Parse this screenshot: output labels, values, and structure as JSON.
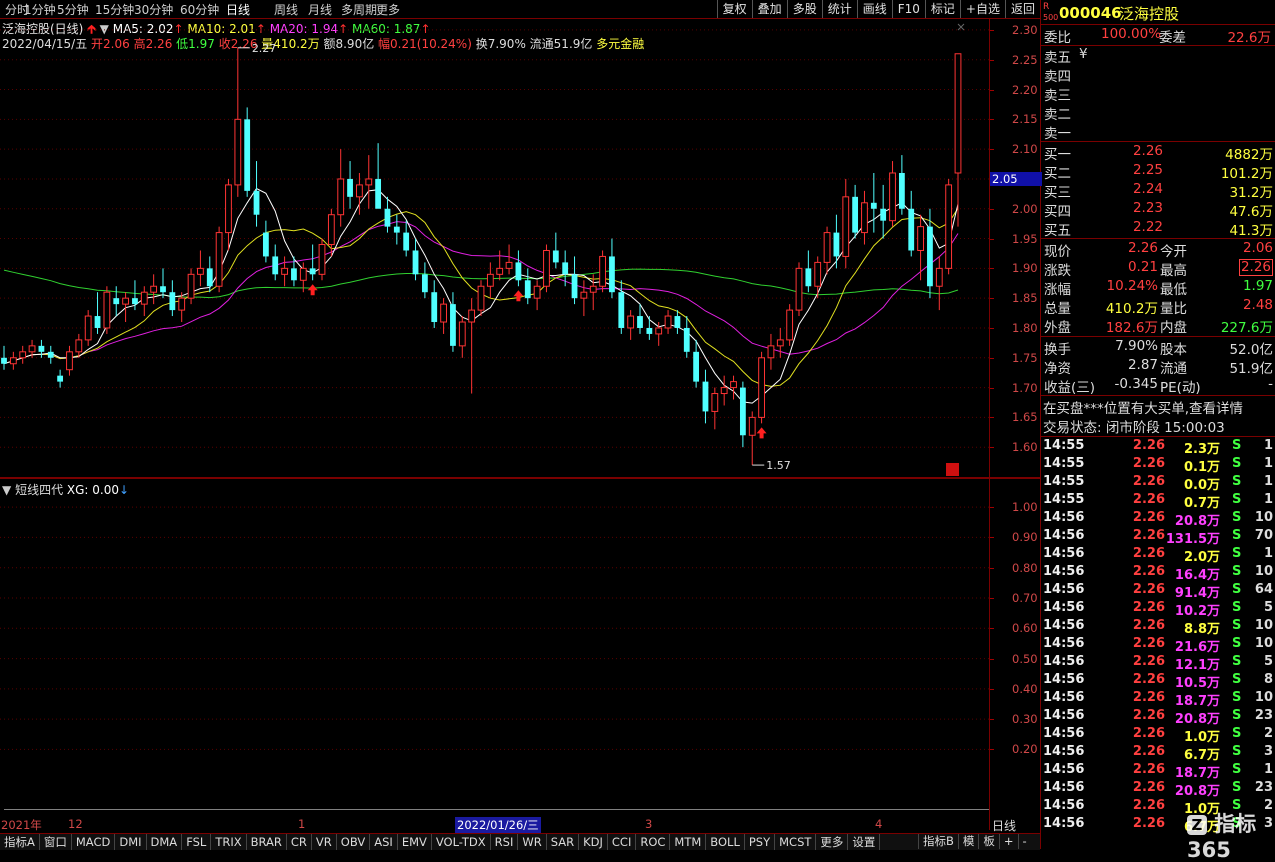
{
  "toolbar": {
    "timeframes": [
      "分时",
      "1分钟",
      "5分钟",
      "15分钟",
      "30分钟",
      "60分钟",
      "日线",
      "周线",
      "月线",
      "多周期",
      "更多"
    ],
    "active_timeframe": "日线",
    "buttons": [
      "复权",
      "叠加",
      "多股",
      "统计",
      "画线",
      "F10",
      "标记",
      "+自选",
      "返回"
    ]
  },
  "chart_header": {
    "name": "泛海控股(日线)",
    "ma5": "MA5: 2.02",
    "ma10": "MA10: 2.01",
    "ma20": "MA20: 1.94",
    "ma60": "MA60: 1.87"
  },
  "day_info": {
    "date": "2022/04/15/五",
    "open": "开2.06",
    "high": "高2.26",
    "low": "低1.97",
    "close": "收2.26",
    "volume": "量410.2万",
    "amount": "额8.90亿",
    "change": "幅0.21(10.24%)",
    "turnover": "换7.90%",
    "float": "流通51.9亿",
    "concept": "多元金融"
  },
  "indicator": {
    "name": "短线四代",
    "value": "XG: 0.00"
  },
  "bottom_tabs": [
    "指标A",
    "窗口",
    "MACD",
    "DMI",
    "DMA",
    "FSL",
    "TRIX",
    "BRAR",
    "CR",
    "VR",
    "OBV",
    "ASI",
    "EMV",
    "VOL-TDX",
    "RSI",
    "WR",
    "SAR",
    "KDJ",
    "CCI",
    "ROC",
    "MTM",
    "BOLL",
    "PSY",
    "MCST",
    "更多",
    "设置"
  ],
  "bottom_right": [
    "指标B",
    "模",
    "板",
    "+",
    "-"
  ],
  "axis_right_label": "日线",
  "date_labels": [
    {
      "text": "2021年",
      "highlight": false
    },
    {
      "text": "12",
      "highlight": false
    },
    {
      "text": "1",
      "highlight": false
    },
    {
      "text": "2022/01/26/三",
      "highlight": true
    },
    {
      "text": "3",
      "highlight": false
    },
    {
      "text": "4",
      "highlight": false
    }
  ],
  "chart_data": {
    "type": "candlestick",
    "price_ticks": [
      "2.30",
      "2.25",
      "2.20",
      "2.15",
      "2.10",
      "2.05",
      "2.00",
      "1.95",
      "1.90",
      "1.85",
      "1.80",
      "1.75",
      "1.70",
      "1.65",
      "1.60"
    ],
    "ylim": [
      1.55,
      2.32
    ],
    "current_price_tag": "2.05",
    "high_annotation": "2.27",
    "low_annotation": "1.57",
    "indicator_ticks": [
      "1.00",
      "0.90",
      "0.80",
      "0.70",
      "0.60",
      "0.50",
      "0.40",
      "0.30",
      "0.20"
    ],
    "indicator_ylim": [
      0,
      1.05
    ],
    "indicator_values": [
      0,
      0,
      0,
      0,
      0,
      0,
      0,
      0,
      0,
      0,
      0,
      0,
      0,
      0,
      0,
      0,
      0,
      0,
      0,
      0,
      0,
      0,
      0,
      0,
      0,
      0,
      0,
      0,
      0,
      0,
      0,
      0,
      0,
      0,
      0,
      0,
      0,
      0,
      0,
      0,
      0,
      0,
      0,
      0,
      0,
      0,
      0,
      0,
      0,
      0,
      0,
      0,
      0,
      0,
      0,
      0,
      0,
      0,
      0,
      0,
      0,
      0,
      0,
      0,
      0,
      0,
      0,
      0,
      0,
      0,
      0,
      0,
      0,
      0,
      0,
      0,
      0,
      0,
      0,
      0,
      0,
      0,
      0,
      0,
      0,
      0,
      0,
      0,
      0,
      0,
      0,
      0,
      0,
      0,
      0,
      0,
      0,
      0,
      0,
      0,
      0,
      0,
      0,
      0,
      0,
      0,
      0,
      0,
      0,
      0,
      0,
      0,
      0,
      0,
      0,
      1,
      0
    ],
    "candles": [
      [
        1.75,
        1.77,
        1.73,
        1.74
      ],
      [
        1.74,
        1.76,
        1.73,
        1.75
      ],
      [
        1.75,
        1.77,
        1.74,
        1.76
      ],
      [
        1.76,
        1.78,
        1.75,
        1.77
      ],
      [
        1.77,
        1.78,
        1.75,
        1.76
      ],
      [
        1.76,
        1.77,
        1.74,
        1.75
      ],
      [
        1.72,
        1.73,
        1.7,
        1.71
      ],
      [
        1.73,
        1.77,
        1.72,
        1.76
      ],
      [
        1.76,
        1.79,
        1.75,
        1.78
      ],
      [
        1.78,
        1.83,
        1.77,
        1.82
      ],
      [
        1.82,
        1.86,
        1.79,
        1.8
      ],
      [
        1.8,
        1.87,
        1.79,
        1.86
      ],
      [
        1.85,
        1.87,
        1.82,
        1.84
      ],
      [
        1.84,
        1.86,
        1.81,
        1.85
      ],
      [
        1.85,
        1.88,
        1.83,
        1.84
      ],
      [
        1.84,
        1.87,
        1.82,
        1.86
      ],
      [
        1.86,
        1.89,
        1.84,
        1.87
      ],
      [
        1.87,
        1.9,
        1.85,
        1.86
      ],
      [
        1.86,
        1.88,
        1.82,
        1.83
      ],
      [
        1.83,
        1.86,
        1.81,
        1.85
      ],
      [
        1.85,
        1.9,
        1.84,
        1.89
      ],
      [
        1.89,
        1.93,
        1.87,
        1.9
      ],
      [
        1.9,
        1.92,
        1.86,
        1.87
      ],
      [
        1.87,
        1.97,
        1.86,
        1.96
      ],
      [
        1.96,
        2.05,
        1.93,
        2.04
      ],
      [
        2.04,
        2.27,
        2.02,
        2.15
      ],
      [
        2.15,
        2.17,
        2.02,
        2.03
      ],
      [
        2.03,
        2.08,
        1.97,
        1.99
      ],
      [
        1.96,
        1.98,
        1.91,
        1.92
      ],
      [
        1.92,
        1.94,
        1.88,
        1.89
      ],
      [
        1.89,
        1.92,
        1.87,
        1.9
      ],
      [
        1.9,
        1.92,
        1.87,
        1.88
      ],
      [
        1.88,
        1.91,
        1.86,
        1.9
      ],
      [
        1.9,
        1.94,
        1.88,
        1.89
      ],
      [
        1.89,
        1.95,
        1.88,
        1.94
      ],
      [
        1.94,
        2.0,
        1.92,
        1.99
      ],
      [
        1.99,
        2.1,
        1.97,
        2.05
      ],
      [
        2.05,
        2.08,
        2.0,
        2.02
      ],
      [
        2.02,
        2.06,
        1.99,
        2.04
      ],
      [
        2.04,
        2.09,
        2.0,
        2.05
      ],
      [
        2.05,
        2.11,
        2.02,
        2.0
      ],
      [
        2.0,
        2.02,
        1.96,
        1.97
      ],
      [
        1.97,
        1.99,
        1.94,
        1.96
      ],
      [
        1.96,
        1.98,
        1.92,
        1.93
      ],
      [
        1.93,
        1.95,
        1.88,
        1.89
      ],
      [
        1.89,
        1.91,
        1.85,
        1.86
      ],
      [
        1.86,
        1.88,
        1.8,
        1.81
      ],
      [
        1.81,
        1.85,
        1.79,
        1.84
      ],
      [
        1.84,
        1.86,
        1.76,
        1.77
      ],
      [
        1.77,
        1.82,
        1.75,
        1.81
      ],
      [
        1.81,
        1.85,
        1.69,
        1.83
      ],
      [
        1.83,
        1.88,
        1.82,
        1.87
      ],
      [
        1.87,
        1.91,
        1.85,
        1.89
      ],
      [
        1.89,
        1.93,
        1.88,
        1.9
      ],
      [
        1.9,
        1.94,
        1.89,
        1.91
      ],
      [
        1.91,
        1.93,
        1.87,
        1.88
      ],
      [
        1.88,
        1.9,
        1.84,
        1.85
      ],
      [
        1.85,
        1.88,
        1.83,
        1.87
      ],
      [
        1.87,
        1.94,
        1.86,
        1.93
      ],
      [
        1.93,
        1.96,
        1.9,
        1.91
      ],
      [
        1.91,
        1.93,
        1.87,
        1.89
      ],
      [
        1.89,
        1.92,
        1.84,
        1.85
      ],
      [
        1.85,
        1.88,
        1.82,
        1.86
      ],
      [
        1.86,
        1.89,
        1.83,
        1.87
      ],
      [
        1.87,
        1.93,
        1.86,
        1.92
      ],
      [
        1.92,
        1.95,
        1.85,
        1.86
      ],
      [
        1.86,
        1.88,
        1.79,
        1.8
      ],
      [
        1.8,
        1.83,
        1.78,
        1.82
      ],
      [
        1.82,
        1.84,
        1.79,
        1.8
      ],
      [
        1.8,
        1.82,
        1.78,
        1.79
      ],
      [
        1.79,
        1.81,
        1.77,
        1.8
      ],
      [
        1.8,
        1.83,
        1.79,
        1.82
      ],
      [
        1.82,
        1.83,
        1.79,
        1.8
      ],
      [
        1.8,
        1.82,
        1.75,
        1.76
      ],
      [
        1.76,
        1.78,
        1.7,
        1.71
      ],
      [
        1.71,
        1.73,
        1.64,
        1.66
      ],
      [
        1.66,
        1.7,
        1.63,
        1.69
      ],
      [
        1.69,
        1.72,
        1.67,
        1.7
      ],
      [
        1.7,
        1.72,
        1.68,
        1.71
      ],
      [
        1.7,
        1.71,
        1.6,
        1.62
      ],
      [
        1.62,
        1.66,
        1.57,
        1.65
      ],
      [
        1.65,
        1.76,
        1.64,
        1.75
      ],
      [
        1.75,
        1.79,
        1.73,
        1.77
      ],
      [
        1.77,
        1.8,
        1.75,
        1.78
      ],
      [
        1.78,
        1.84,
        1.77,
        1.83
      ],
      [
        1.83,
        1.91,
        1.82,
        1.9
      ],
      [
        1.9,
        1.93,
        1.86,
        1.87
      ],
      [
        1.87,
        1.92,
        1.85,
        1.91
      ],
      [
        1.91,
        1.97,
        1.89,
        1.96
      ],
      [
        1.96,
        1.99,
        1.9,
        1.92
      ],
      [
        1.92,
        2.05,
        1.9,
        2.02
      ],
      [
        2.02,
        2.04,
        1.95,
        1.96
      ],
      [
        1.96,
        2.03,
        1.94,
        2.01
      ],
      [
        2.01,
        2.06,
        1.96,
        2.0
      ],
      [
        2.0,
        2.04,
        1.95,
        1.98
      ],
      [
        1.98,
        2.08,
        1.97,
        2.06
      ],
      [
        2.06,
        2.09,
        1.99,
        2.0
      ],
      [
        2.0,
        2.03,
        1.92,
        1.93
      ],
      [
        1.93,
        1.99,
        1.88,
        1.97
      ],
      [
        1.97,
        2.0,
        1.85,
        1.87
      ],
      [
        1.87,
        1.92,
        1.83,
        1.9
      ],
      [
        1.9,
        2.05,
        1.89,
        2.04
      ],
      [
        2.06,
        2.26,
        1.97,
        2.26
      ]
    ]
  },
  "quote": {
    "code": "000046",
    "name": "泛海控股",
    "code_prefix": "R",
    "code_sub": "500",
    "webi_label": "委比",
    "webi_value": "100.00%",
    "weicha_label": "委差",
    "weicha_value": "22.6万",
    "asks": [
      {
        "label": "卖五",
        "price": "¥",
        "vol": ""
      },
      {
        "label": "卖四",
        "price": "",
        "vol": ""
      },
      {
        "label": "卖三",
        "price": "",
        "vol": ""
      },
      {
        "label": "卖二",
        "price": "",
        "vol": ""
      },
      {
        "label": "卖一",
        "price": "",
        "vol": ""
      }
    ],
    "bids": [
      {
        "label": "买一",
        "price": "2.26",
        "vol": "4882万"
      },
      {
        "label": "买二",
        "price": "2.25",
        "vol": "101.2万"
      },
      {
        "label": "买三",
        "price": "2.24",
        "vol": "31.2万"
      },
      {
        "label": "买四",
        "price": "2.23",
        "vol": "47.6万"
      },
      {
        "label": "买五",
        "price": "2.22",
        "vol": "41.3万"
      }
    ],
    "stats": [
      {
        "l1": "现价",
        "v1": "2.26",
        "l2": "今开",
        "v2": "2.06"
      },
      {
        "l1": "涨跌",
        "v1": "0.21",
        "l2": "最高",
        "v2": "2.26"
      },
      {
        "l1": "涨幅",
        "v1": "10.24%",
        "l2": "最低",
        "v2": "1.97"
      },
      {
        "l1": "总量",
        "v1": "410.2万",
        "l2": "量比",
        "v2": "2.48"
      },
      {
        "l1": "外盘",
        "v1": "182.6万",
        "l2": "内盘",
        "v2": "227.6万"
      }
    ],
    "stats2": [
      {
        "l1": "换手",
        "v1": "7.90%",
        "l2": "股本",
        "v2": "52.0亿"
      },
      {
        "l1": "净资",
        "v1": "2.87",
        "l2": "流通",
        "v2": "51.9亿"
      },
      {
        "l1": "收益(三)",
        "v1": "-0.345",
        "l2": "PE(动)",
        "v2": "-"
      }
    ],
    "notice": "在买盘***位置有大买单,查看详情",
    "trade_status": "交易状态: 闭市阶段 15:00:03"
  },
  "ticks": [
    {
      "t": "14:55",
      "p": "2.26",
      "v": "2.3万",
      "s": "S",
      "n": "1"
    },
    {
      "t": "14:55",
      "p": "2.26",
      "v": "0.1万",
      "s": "S",
      "n": "1"
    },
    {
      "t": "14:55",
      "p": "2.26",
      "v": "0.0万",
      "s": "S",
      "n": "1"
    },
    {
      "t": "14:55",
      "p": "2.26",
      "v": "0.7万",
      "s": "S",
      "n": "1"
    },
    {
      "t": "14:56",
      "p": "2.26",
      "v": "20.8万",
      "s": "S",
      "n": "10"
    },
    {
      "t": "14:56",
      "p": "2.26",
      "v": "131.5万",
      "s": "S",
      "n": "70"
    },
    {
      "t": "14:56",
      "p": "2.26",
      "v": "2.0万",
      "s": "S",
      "n": "1"
    },
    {
      "t": "14:56",
      "p": "2.26",
      "v": "16.4万",
      "s": "S",
      "n": "10"
    },
    {
      "t": "14:56",
      "p": "2.26",
      "v": "91.4万",
      "s": "S",
      "n": "64"
    },
    {
      "t": "14:56",
      "p": "2.26",
      "v": "10.2万",
      "s": "S",
      "n": "5"
    },
    {
      "t": "14:56",
      "p": "2.26",
      "v": "8.8万",
      "s": "S",
      "n": "10"
    },
    {
      "t": "14:56",
      "p": "2.26",
      "v": "21.6万",
      "s": "S",
      "n": "10"
    },
    {
      "t": "14:56",
      "p": "2.26",
      "v": "12.1万",
      "s": "S",
      "n": "5"
    },
    {
      "t": "14:56",
      "p": "2.26",
      "v": "10.5万",
      "s": "S",
      "n": "8"
    },
    {
      "t": "14:56",
      "p": "2.26",
      "v": "18.7万",
      "s": "S",
      "n": "10"
    },
    {
      "t": "14:56",
      "p": "2.26",
      "v": "20.8万",
      "s": "S",
      "n": "23"
    },
    {
      "t": "14:56",
      "p": "2.26",
      "v": "1.0万",
      "s": "S",
      "n": "2"
    },
    {
      "t": "14:56",
      "p": "2.26",
      "v": "6.7万",
      "s": "S",
      "n": "3"
    },
    {
      "t": "14:56",
      "p": "2.26",
      "v": "18.7万",
      "s": "S",
      "n": "1"
    },
    {
      "t": "14:56",
      "p": "2.26",
      "v": "20.8万",
      "s": "S",
      "n": "23"
    },
    {
      "t": "14:56",
      "p": "2.26",
      "v": "1.0万",
      "s": "S",
      "n": "2"
    },
    {
      "t": "14:56",
      "p": "2.26",
      "v": "6.7万",
      "s": "S",
      "n": "3"
    }
  ],
  "watermark": "指标365"
}
